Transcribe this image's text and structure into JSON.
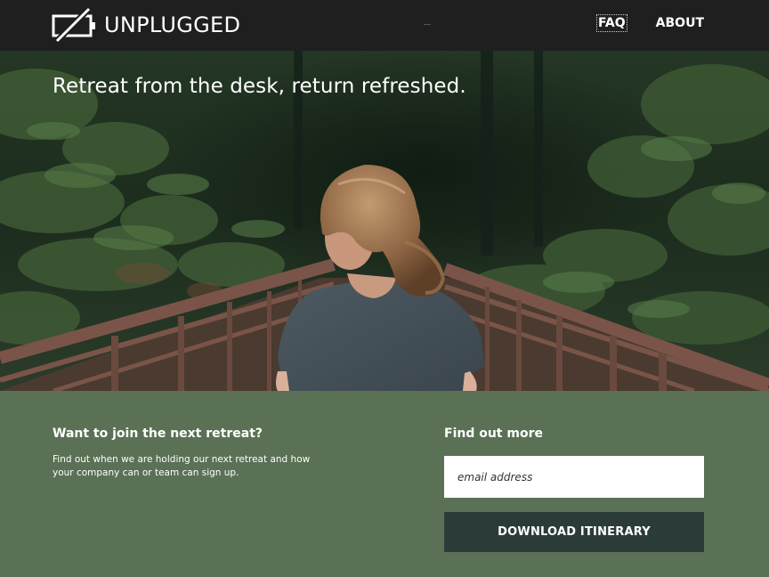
{
  "header": {
    "brand": "UNPLUGGED",
    "logo_icon": "unplugged-battery-icon",
    "nav": [
      {
        "label": "FAQ"
      },
      {
        "label": "ABOUT"
      }
    ]
  },
  "hero": {
    "title": "Retreat from the desk, return refreshed.",
    "image": "woman-on-forest-bridge-photo"
  },
  "join": {
    "heading": "Want to join the next retreat?",
    "text": "Find out when we are holding our next retreat and how your company can or team can sign up."
  },
  "signup": {
    "heading": "Find out more",
    "email_placeholder": "email address",
    "button_label": "DOWNLOAD ITINERARY"
  },
  "colors": {
    "header_bg": "#1f1f1f",
    "section_bg": "#5a7156",
    "button_bg": "#2b3c38",
    "text": "#ffffff"
  }
}
